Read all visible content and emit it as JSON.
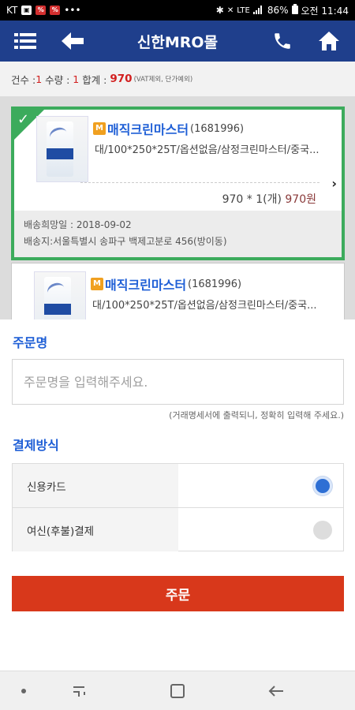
{
  "status_bar": {
    "carrier": "KT",
    "battery": "86%",
    "time": "오전 11:44"
  },
  "header": {
    "title": "신한MRO몰"
  },
  "summary": {
    "count_label": "건수 : ",
    "count": "1",
    "qty_label": " 수량 : ",
    "qty": "1",
    "total_label": " 합계 : ",
    "total": "970",
    "total_note": "(VAT제외, 단가예외)"
  },
  "cart_items": [
    {
      "badge": "M",
      "name": "매직크린마스터",
      "code": "(1681996)",
      "desc": "대/100*250*25T/옵션없음/삼정크린마스터/중국...",
      "price_line": "970 * 1(개) ",
      "price_won": "970원",
      "delivery_date": "배송희망일 : 2018-09-02",
      "delivery_addr": "배송지:서울특별시 송파구 백제고분로 456(방이동)"
    },
    {
      "badge": "M",
      "name": "매직크린마스터",
      "code": "(1681996)",
      "desc": "대/100*250*25T/옵션없음/삼정크린마스터/중국..."
    }
  ],
  "form": {
    "order_name_title": "주문명",
    "order_name_placeholder": "주문명을 입력해주세요.",
    "order_name_hint": "(거래명세서에 출력되니, 정확히 입력해 주세요.)",
    "payment_title": "결제방식",
    "payment_options": [
      {
        "label": "신용카드",
        "selected": true
      },
      {
        "label": "여신(후불)결제",
        "selected": false
      }
    ],
    "order_button": "주문"
  },
  "colors": {
    "header_bg": "#1f3f8c",
    "accent_blue": "#1f5fd6",
    "selected_green": "#3cab5c",
    "order_red": "#d8381b"
  }
}
